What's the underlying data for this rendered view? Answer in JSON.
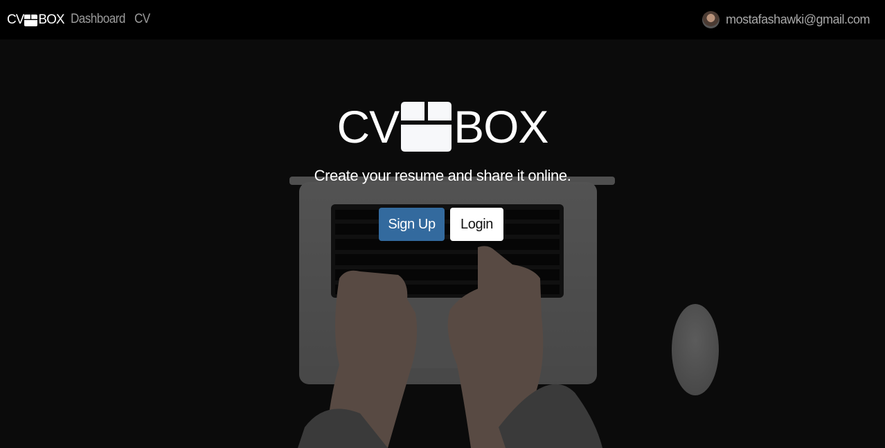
{
  "navbar": {
    "brand_left": "CV",
    "brand_right": "BOX",
    "links": [
      "Dashboard",
      "CV"
    ],
    "user_email": "mostafashawki@gmail.com"
  },
  "hero": {
    "logo_left": "CV",
    "logo_right": "BOX",
    "tagline": "Create your resume and share it online.",
    "signup_label": "Sign Up",
    "login_label": "Login"
  },
  "icons": {
    "brand": "box-icon",
    "avatar": "user-avatar"
  },
  "colors": {
    "navbar_bg": "#000000",
    "signup_bg": "#336a9e",
    "login_bg": "#ffffff"
  }
}
